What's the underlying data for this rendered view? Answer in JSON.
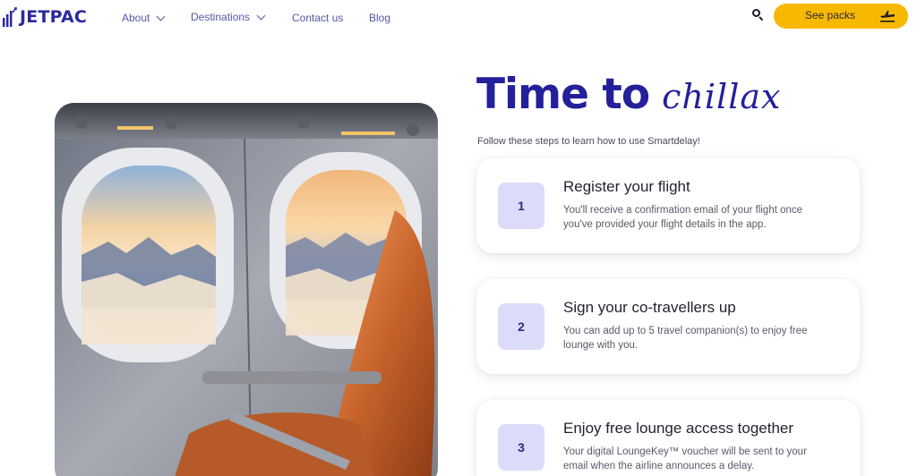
{
  "brand": {
    "name": "JETPAC",
    "color": "#2a2a9e"
  },
  "nav": {
    "items": [
      {
        "label": "About",
        "has_dropdown": true
      },
      {
        "label": "Destinations",
        "has_dropdown": true
      },
      {
        "label": "Contact us",
        "has_dropdown": false
      },
      {
        "label": "Blog",
        "has_dropdown": false
      }
    ],
    "search_icon": "search-icon",
    "cta": {
      "label": "See packs",
      "icon": "airplane-icon",
      "color": "#f7b800"
    }
  },
  "hero": {
    "title_main": "Time to",
    "title_script": "chillax",
    "subtitle": "Follow these steps to learn how to use Smartdelay!",
    "accent": "#23209a"
  },
  "steps": [
    {
      "number": "1",
      "title": "Register your flight",
      "description": "You'll receive a confirmation email of your flight once you've provided your flight details in the app."
    },
    {
      "number": "2",
      "title": "Sign your co-travellers up",
      "description": "You can add up to 5 travel companion(s) to enjoy free lounge with you."
    },
    {
      "number": "3",
      "title": "Enjoy free lounge access together",
      "description": "Your digital LoungeKey™ voucher will be sent to your email when the airline announces a delay."
    }
  ]
}
